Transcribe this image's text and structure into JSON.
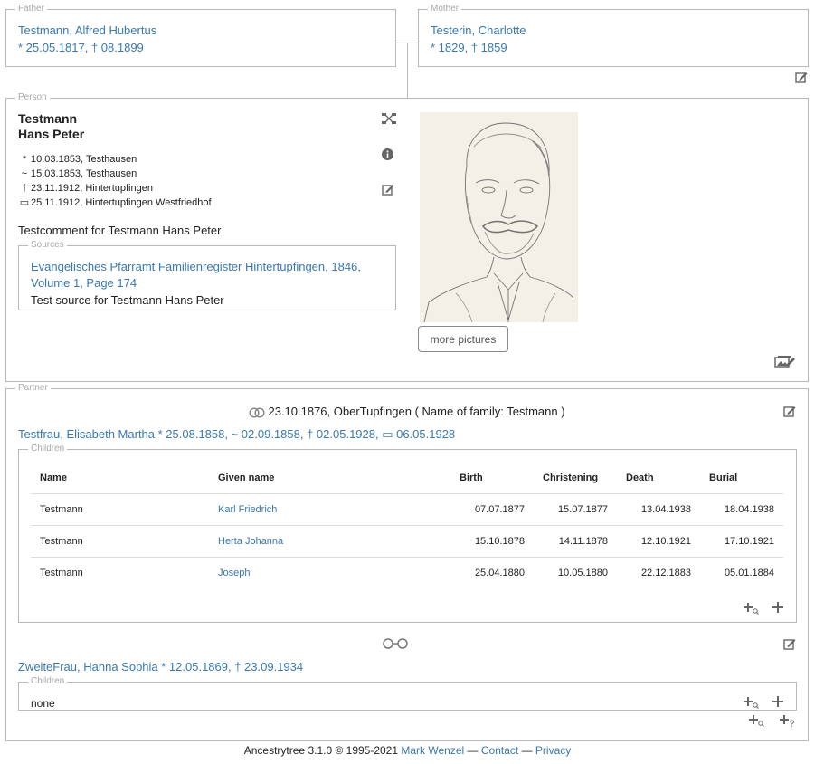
{
  "father": {
    "legend": "Father",
    "name": "Testmann, Alfred Hubertus",
    "dates": "* 25.05.1817, † 08.1899"
  },
  "mother": {
    "legend": "Mother",
    "name": "Testerin, Charlotte",
    "dates": "* 1829, † 1859"
  },
  "person": {
    "legend": "Person",
    "surname": "Testmann",
    "given": "Hans Peter",
    "events": [
      {
        "symbol": "*",
        "text": "10.03.1853, Testhausen"
      },
      {
        "symbol": "~",
        "text": "15.03.1853, Testhausen"
      },
      {
        "symbol": "†",
        "text": "23.11.1912, Hintertupfingen"
      },
      {
        "symbol": "▭",
        "text": "25.11.1912, Hintertupfingen Westfriedhof"
      }
    ],
    "comment": "Testcomment for Testmann Hans Peter",
    "sources_legend": "Sources",
    "source_link": "Evangelisches Pfarramt Familienregister Hintertupfingen, 1846, Volume 1, Page 174",
    "source_text": "Test source for Testmann Hans Peter",
    "more_pictures": "more pictures",
    "icons": [
      "tree-icon",
      "info-icon",
      "edit-icon",
      "pictures-edit-icon"
    ]
  },
  "partner": {
    "legend": "Partner",
    "marriage1": "23.10.1876, OberTupfingen ( Name of family: Testmann )",
    "partner1": "Testfrau, Elisabeth Martha * 25.08.1858, ~ 02.09.1858, † 02.05.1928, ▭ 06.05.1928",
    "children_legend": "Children",
    "columns": [
      "Name",
      "Given name",
      "Birth",
      "Christening",
      "Death",
      "Burial"
    ],
    "children": [
      {
        "name": "Testmann",
        "given": "Karl Friedrich",
        "birth": "07.07.1877",
        "christening": "15.07.1877",
        "death": "13.04.1938",
        "burial": "18.04.1938"
      },
      {
        "name": "Testmann",
        "given": "Herta Johanna",
        "birth": "15.10.1878",
        "christening": "14.11.1878",
        "death": "12.10.1921",
        "burial": "17.10.1921"
      },
      {
        "name": "Testmann",
        "given": "Joseph",
        "birth": "25.04.1880",
        "christening": "10.05.1880",
        "death": "22.12.1883",
        "burial": "05.01.1884"
      }
    ],
    "partner2": "ZweiteFrau, Hanna Sophia * 12.05.1869, † 23.09.1934",
    "children2_none": "none"
  },
  "footer": {
    "prefix": "Ancestrytree 3.1.0 © 1995-2021",
    "author": "Mark Wenzel",
    "sep1": "—",
    "contact": "Contact",
    "sep2": "—",
    "privacy": "Privacy"
  },
  "colors": {
    "link": "#3a78b0",
    "border": "#b8b8b8",
    "legend": "#a8a8a8"
  }
}
